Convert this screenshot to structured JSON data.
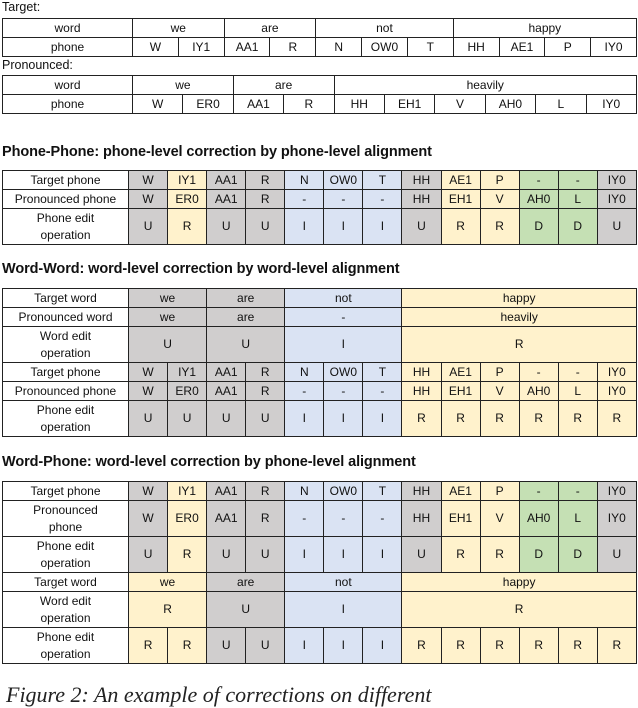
{
  "intro": {
    "target_label": "Target:",
    "pronounced_label": "Pronounced:",
    "target_table": {
      "rows": [
        {
          "header": "word",
          "cells": [
            {
              "text": "we",
              "span": 2
            },
            {
              "text": "are",
              "span": 2
            },
            {
              "text": "not",
              "span": 3
            },
            {
              "text": "happy",
              "span": 4
            }
          ]
        },
        {
          "header": "phone",
          "cells": [
            {
              "text": "W"
            },
            {
              "text": "IY1"
            },
            {
              "text": "AA1"
            },
            {
              "text": "R"
            },
            {
              "text": "N"
            },
            {
              "text": "OW0"
            },
            {
              "text": "T"
            },
            {
              "text": "HH"
            },
            {
              "text": "AE1"
            },
            {
              "text": "P"
            },
            {
              "text": "IY0"
            }
          ]
        }
      ]
    },
    "pronounced_table": {
      "rows": [
        {
          "header": "word",
          "cells": [
            {
              "text": "we",
              "span": 2
            },
            {
              "text": "are",
              "span": 2
            },
            {
              "text": "heavily",
              "span": 6
            }
          ]
        },
        {
          "header": "phone",
          "cells": [
            {
              "text": "W"
            },
            {
              "text": "ER0"
            },
            {
              "text": "AA1"
            },
            {
              "text": "R"
            },
            {
              "text": "HH"
            },
            {
              "text": "EH1"
            },
            {
              "text": "V"
            },
            {
              "text": "AH0"
            },
            {
              "text": "L"
            },
            {
              "text": "IY0"
            }
          ]
        }
      ]
    }
  },
  "legend_colors": {
    "U": "#d0cece",
    "R": "#fff2cc",
    "I": "#dae3f3",
    "D": "#c5e0b4"
  },
  "sections": [
    {
      "title": "Phone-Phone: phone-level correction by phone-level alignment",
      "rows": [
        {
          "header": "Target phone",
          "tall": false,
          "cells": [
            {
              "text": "W",
              "op": "U"
            },
            {
              "text": "IY1",
              "op": "R"
            },
            {
              "text": "AA1",
              "op": "U"
            },
            {
              "text": "R",
              "op": "U"
            },
            {
              "text": "N",
              "op": "I"
            },
            {
              "text": "OW0",
              "op": "I"
            },
            {
              "text": "T",
              "op": "I"
            },
            {
              "text": "HH",
              "op": "U"
            },
            {
              "text": "AE1",
              "op": "R"
            },
            {
              "text": "P",
              "op": "R"
            },
            {
              "text": "-",
              "op": "D"
            },
            {
              "text": "-",
              "op": "D"
            },
            {
              "text": "IY0",
              "op": "U"
            }
          ]
        },
        {
          "header": "Pronounced phone",
          "tall": false,
          "cells": [
            {
              "text": "W",
              "op": "U"
            },
            {
              "text": "ER0",
              "op": "R"
            },
            {
              "text": "AA1",
              "op": "U"
            },
            {
              "text": "R",
              "op": "U"
            },
            {
              "text": "-",
              "op": "I"
            },
            {
              "text": "-",
              "op": "I"
            },
            {
              "text": "-",
              "op": "I"
            },
            {
              "text": "HH",
              "op": "U"
            },
            {
              "text": "EH1",
              "op": "R"
            },
            {
              "text": "V",
              "op": "R"
            },
            {
              "text": "AH0",
              "op": "D"
            },
            {
              "text": "L",
              "op": "D"
            },
            {
              "text": "IY0",
              "op": "U"
            }
          ]
        },
        {
          "header": "Phone edit operation",
          "tall": true,
          "cells": [
            {
              "text": "U",
              "op": "U"
            },
            {
              "text": "R",
              "op": "R"
            },
            {
              "text": "U",
              "op": "U"
            },
            {
              "text": "U",
              "op": "U"
            },
            {
              "text": "I",
              "op": "I"
            },
            {
              "text": "I",
              "op": "I"
            },
            {
              "text": "I",
              "op": "I"
            },
            {
              "text": "U",
              "op": "U"
            },
            {
              "text": "R",
              "op": "R"
            },
            {
              "text": "R",
              "op": "R"
            },
            {
              "text": "D",
              "op": "D"
            },
            {
              "text": "D",
              "op": "D"
            },
            {
              "text": "U",
              "op": "U"
            }
          ]
        }
      ]
    },
    {
      "title": "Word-Word: word-level correction by word-level alignment",
      "rows": [
        {
          "header": "Target word",
          "tall": false,
          "cells": [
            {
              "text": "we",
              "op": "U",
              "span": 2
            },
            {
              "text": "are",
              "op": "U",
              "span": 2
            },
            {
              "text": "not",
              "op": "I",
              "span": 3
            },
            {
              "text": "happy",
              "op": "R",
              "span": 6
            }
          ]
        },
        {
          "header": "Pronounced word",
          "tall": false,
          "cells": [
            {
              "text": "we",
              "op": "U",
              "span": 2
            },
            {
              "text": "are",
              "op": "U",
              "span": 2
            },
            {
              "text": "-",
              "op": "I",
              "span": 3
            },
            {
              "text": "heavily",
              "op": "R",
              "span": 6
            }
          ]
        },
        {
          "header": "Word edit operation",
          "tall": true,
          "cells": [
            {
              "text": "U",
              "op": "U",
              "span": 2
            },
            {
              "text": "U",
              "op": "U",
              "span": 2
            },
            {
              "text": "I",
              "op": "I",
              "span": 3
            },
            {
              "text": "R",
              "op": "R",
              "span": 6
            }
          ]
        },
        {
          "header": "Target phone",
          "tall": false,
          "cells": [
            {
              "text": "W",
              "op": "U"
            },
            {
              "text": "IY1",
              "op": "U"
            },
            {
              "text": "AA1",
              "op": "U"
            },
            {
              "text": "R",
              "op": "U"
            },
            {
              "text": "N",
              "op": "I"
            },
            {
              "text": "OW0",
              "op": "I"
            },
            {
              "text": "T",
              "op": "I"
            },
            {
              "text": "HH",
              "op": "R"
            },
            {
              "text": "AE1",
              "op": "R"
            },
            {
              "text": "P",
              "op": "R"
            },
            {
              "text": "-",
              "op": "R"
            },
            {
              "text": "-",
              "op": "R"
            },
            {
              "text": "IY0",
              "op": "R"
            }
          ]
        },
        {
          "header": "Pronounced phone",
          "tall": false,
          "cells": [
            {
              "text": "W",
              "op": "U"
            },
            {
              "text": "ER0",
              "op": "U"
            },
            {
              "text": "AA1",
              "op": "U"
            },
            {
              "text": "R",
              "op": "U"
            },
            {
              "text": "-",
              "op": "I"
            },
            {
              "text": "-",
              "op": "I"
            },
            {
              "text": "-",
              "op": "I"
            },
            {
              "text": "HH",
              "op": "R"
            },
            {
              "text": "EH1",
              "op": "R"
            },
            {
              "text": "V",
              "op": "R"
            },
            {
              "text": "AH0",
              "op": "R"
            },
            {
              "text": "L",
              "op": "R"
            },
            {
              "text": "IY0",
              "op": "R"
            }
          ]
        },
        {
          "header": "Phone edit operation",
          "tall": true,
          "cells": [
            {
              "text": "U",
              "op": "U"
            },
            {
              "text": "U",
              "op": "U"
            },
            {
              "text": "U",
              "op": "U"
            },
            {
              "text": "U",
              "op": "U"
            },
            {
              "text": "I",
              "op": "I"
            },
            {
              "text": "I",
              "op": "I"
            },
            {
              "text": "I",
              "op": "I"
            },
            {
              "text": "R",
              "op": "R"
            },
            {
              "text": "R",
              "op": "R"
            },
            {
              "text": "R",
              "op": "R"
            },
            {
              "text": "R",
              "op": "R"
            },
            {
              "text": "R",
              "op": "R"
            },
            {
              "text": "R",
              "op": "R"
            }
          ]
        }
      ]
    },
    {
      "title": "Word-Phone: word-level correction by phone-level alignment",
      "rows": [
        {
          "header": "Target phone",
          "tall": false,
          "cells": [
            {
              "text": "W",
              "op": "U"
            },
            {
              "text": "IY1",
              "op": "R"
            },
            {
              "text": "AA1",
              "op": "U"
            },
            {
              "text": "R",
              "op": "U"
            },
            {
              "text": "N",
              "op": "I"
            },
            {
              "text": "OW0",
              "op": "I"
            },
            {
              "text": "T",
              "op": "I"
            },
            {
              "text": "HH",
              "op": "U"
            },
            {
              "text": "AE1",
              "op": "R"
            },
            {
              "text": "P",
              "op": "R"
            },
            {
              "text": "-",
              "op": "D"
            },
            {
              "text": "-",
              "op": "D"
            },
            {
              "text": "IY0",
              "op": "U"
            }
          ]
        },
        {
          "header": "Pronounced phone",
          "tall": true,
          "cells": [
            {
              "text": "W",
              "op": "U"
            },
            {
              "text": "ER0",
              "op": "R"
            },
            {
              "text": "AA1",
              "op": "U"
            },
            {
              "text": "R",
              "op": "U"
            },
            {
              "text": "-",
              "op": "I"
            },
            {
              "text": "-",
              "op": "I"
            },
            {
              "text": "-",
              "op": "I"
            },
            {
              "text": "HH",
              "op": "U"
            },
            {
              "text": "EH1",
              "op": "R"
            },
            {
              "text": "V",
              "op": "R"
            },
            {
              "text": "AH0",
              "op": "D"
            },
            {
              "text": "L",
              "op": "D"
            },
            {
              "text": "IY0",
              "op": "U"
            }
          ]
        },
        {
          "header": "Phone edit operation",
          "tall": true,
          "cells": [
            {
              "text": "U",
              "op": "U"
            },
            {
              "text": "R",
              "op": "R"
            },
            {
              "text": "U",
              "op": "U"
            },
            {
              "text": "U",
              "op": "U"
            },
            {
              "text": "I",
              "op": "I"
            },
            {
              "text": "I",
              "op": "I"
            },
            {
              "text": "I",
              "op": "I"
            },
            {
              "text": "U",
              "op": "U"
            },
            {
              "text": "R",
              "op": "R"
            },
            {
              "text": "R",
              "op": "R"
            },
            {
              "text": "D",
              "op": "D"
            },
            {
              "text": "D",
              "op": "D"
            },
            {
              "text": "U",
              "op": "U"
            }
          ]
        },
        {
          "header": "Target word",
          "tall": false,
          "cells": [
            {
              "text": "we",
              "op": "R",
              "span": 2
            },
            {
              "text": "are",
              "op": "U",
              "span": 2
            },
            {
              "text": "not",
              "op": "I",
              "span": 3
            },
            {
              "text": "happy",
              "op": "R",
              "span": 6
            }
          ]
        },
        {
          "header": "Word edit operation",
          "tall": true,
          "cells": [
            {
              "text": "R",
              "op": "R",
              "span": 2
            },
            {
              "text": "U",
              "op": "U",
              "span": 2
            },
            {
              "text": "I",
              "op": "I",
              "span": 3
            },
            {
              "text": "R",
              "op": "R",
              "span": 6
            }
          ]
        },
        {
          "header": "Phone edit operation",
          "tall": true,
          "cells": [
            {
              "text": "R",
              "op": "R"
            },
            {
              "text": "R",
              "op": "R"
            },
            {
              "text": "U",
              "op": "U"
            },
            {
              "text": "U",
              "op": "U"
            },
            {
              "text": "I",
              "op": "I"
            },
            {
              "text": "I",
              "op": "I"
            },
            {
              "text": "I",
              "op": "I"
            },
            {
              "text": "R",
              "op": "R"
            },
            {
              "text": "R",
              "op": "R"
            },
            {
              "text": "R",
              "op": "R"
            },
            {
              "text": "R",
              "op": "R"
            },
            {
              "text": "R",
              "op": "R"
            },
            {
              "text": "R",
              "op": "R"
            }
          ]
        }
      ]
    }
  ],
  "caption": "Figure 2: An example of corrections on different"
}
